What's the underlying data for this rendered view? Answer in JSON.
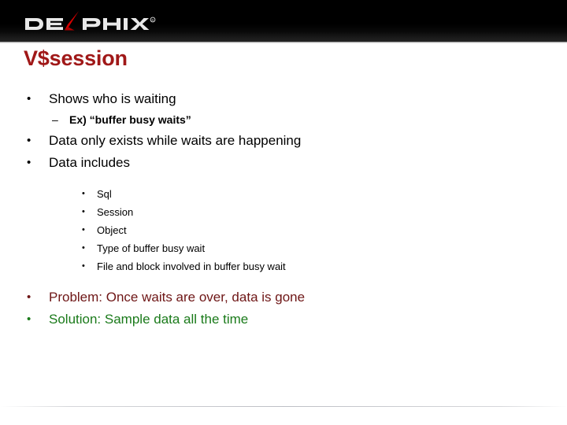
{
  "header": {
    "logo_text": "DELPHIX",
    "logo_trademark": "®",
    "logo_icon": "delphix-swoosh-icon",
    "background_color": "#000000"
  },
  "title": {
    "text": "V$session",
    "color": "#A01818"
  },
  "colors": {
    "title_red": "#A01818",
    "problem_red": "#6E1616",
    "solution_green": "#1A7A1A",
    "body_black": "#000000",
    "slide_background": "#FFFFFF"
  },
  "content": {
    "bullets": [
      {
        "level": 1,
        "marker": "•",
        "text": "Shows who is waiting",
        "color": "#000000"
      },
      {
        "level": 2,
        "marker": "–",
        "text": "Ex) “buffer busy waits”",
        "color": "#000000"
      },
      {
        "level": 1,
        "marker": "•",
        "text": "Data only exists while waits are happening",
        "color": "#000000"
      },
      {
        "level": 1,
        "marker": "•",
        "text": "Data includes",
        "color": "#000000"
      },
      {
        "level": 3,
        "marker": "•",
        "text": "Sql",
        "color": "#000000"
      },
      {
        "level": 3,
        "marker": "•",
        "text": "Session",
        "color": "#000000"
      },
      {
        "level": 3,
        "marker": "•",
        "text": "Object",
        "color": "#000000"
      },
      {
        "level": 3,
        "marker": "•",
        "text": "Type of buffer busy wait",
        "color": "#000000"
      },
      {
        "level": 3,
        "marker": "•",
        "text": "File and block involved in buffer busy wait",
        "color": "#000000"
      },
      {
        "level": 1,
        "marker": "•",
        "text": "Problem: Once waits are over, data is gone",
        "color": "#6E1616"
      },
      {
        "level": 1,
        "marker": "•",
        "text": "Solution: Sample data all the time",
        "color": "#1A7A1A"
      }
    ]
  }
}
